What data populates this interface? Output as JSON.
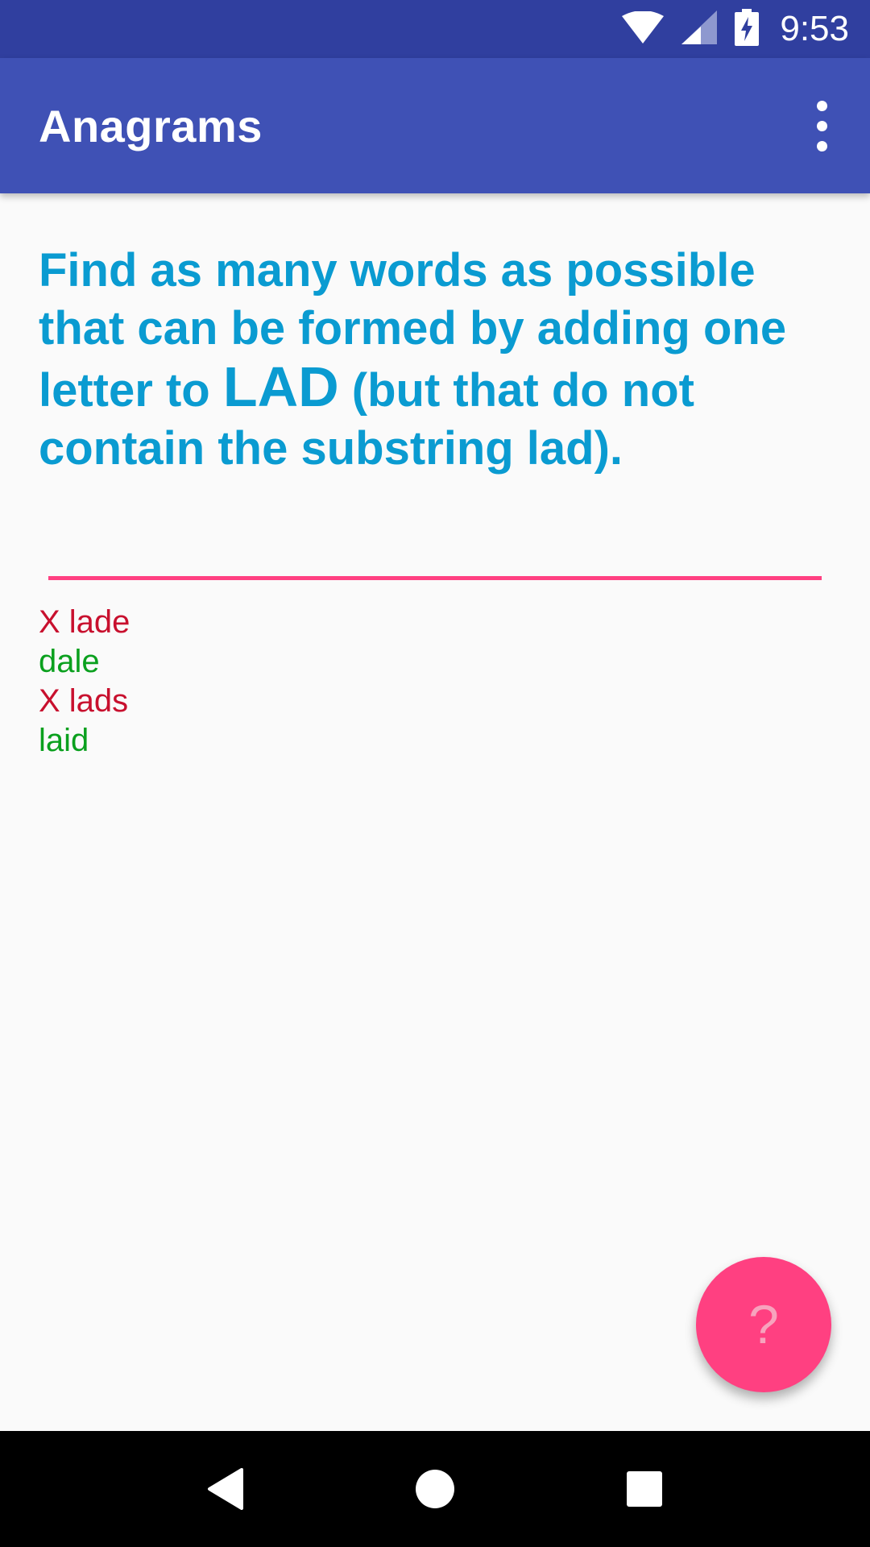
{
  "status_bar": {
    "time": "9:53",
    "icons": [
      "wifi-icon",
      "cell-signal-icon",
      "battery-charging-icon"
    ]
  },
  "app_bar": {
    "title": "Anagrams",
    "menu_icon": "more-vert-icon"
  },
  "instructions": {
    "prefix": "Find as many words as possible that can be formed by adding one letter to ",
    "base_word": "LAD",
    "suffix": " (but that do not contain the substring lad)."
  },
  "input": {
    "value": "",
    "placeholder": ""
  },
  "guesses": [
    {
      "text": "X lade",
      "status": "wrong"
    },
    {
      "text": "dale",
      "status": "right"
    },
    {
      "text": "X lads",
      "status": "wrong"
    },
    {
      "text": "laid",
      "status": "right"
    }
  ],
  "fab": {
    "label": "?",
    "icon": "help-icon"
  },
  "colors": {
    "status_bar": "#303f9f",
    "primary": "#3f51b5",
    "accent": "#ff4081",
    "instruction_text": "#0a9bd1",
    "wrong": "#c8102e",
    "right": "#0aa01e"
  },
  "nav_bar": {
    "icons": [
      "back-icon",
      "home-icon",
      "recents-icon"
    ]
  }
}
